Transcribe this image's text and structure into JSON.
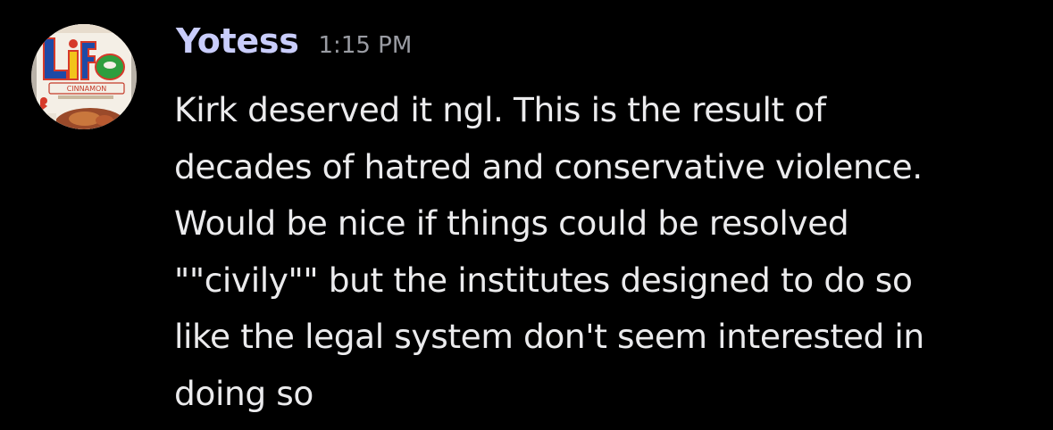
{
  "message": {
    "author": {
      "username": "Yotess",
      "avatar": {
        "logo_text": "Life",
        "flavor_text": "CINNAMON"
      }
    },
    "timestamp": "1:15 PM",
    "content_lines": [
      "Kirk deserved it ngl. This is the result of",
      "decades of hatred and conservative violence.",
      "Would be nice if things could be resolved",
      "\"\"civily\"\" but the institutes designed to do so",
      "like the legal system don't seem interested in",
      "doing so"
    ]
  },
  "colors": {
    "background": "#000000",
    "username": "#c9cdfb",
    "timestamp": "#9a9ca3",
    "text": "#ebebed"
  }
}
